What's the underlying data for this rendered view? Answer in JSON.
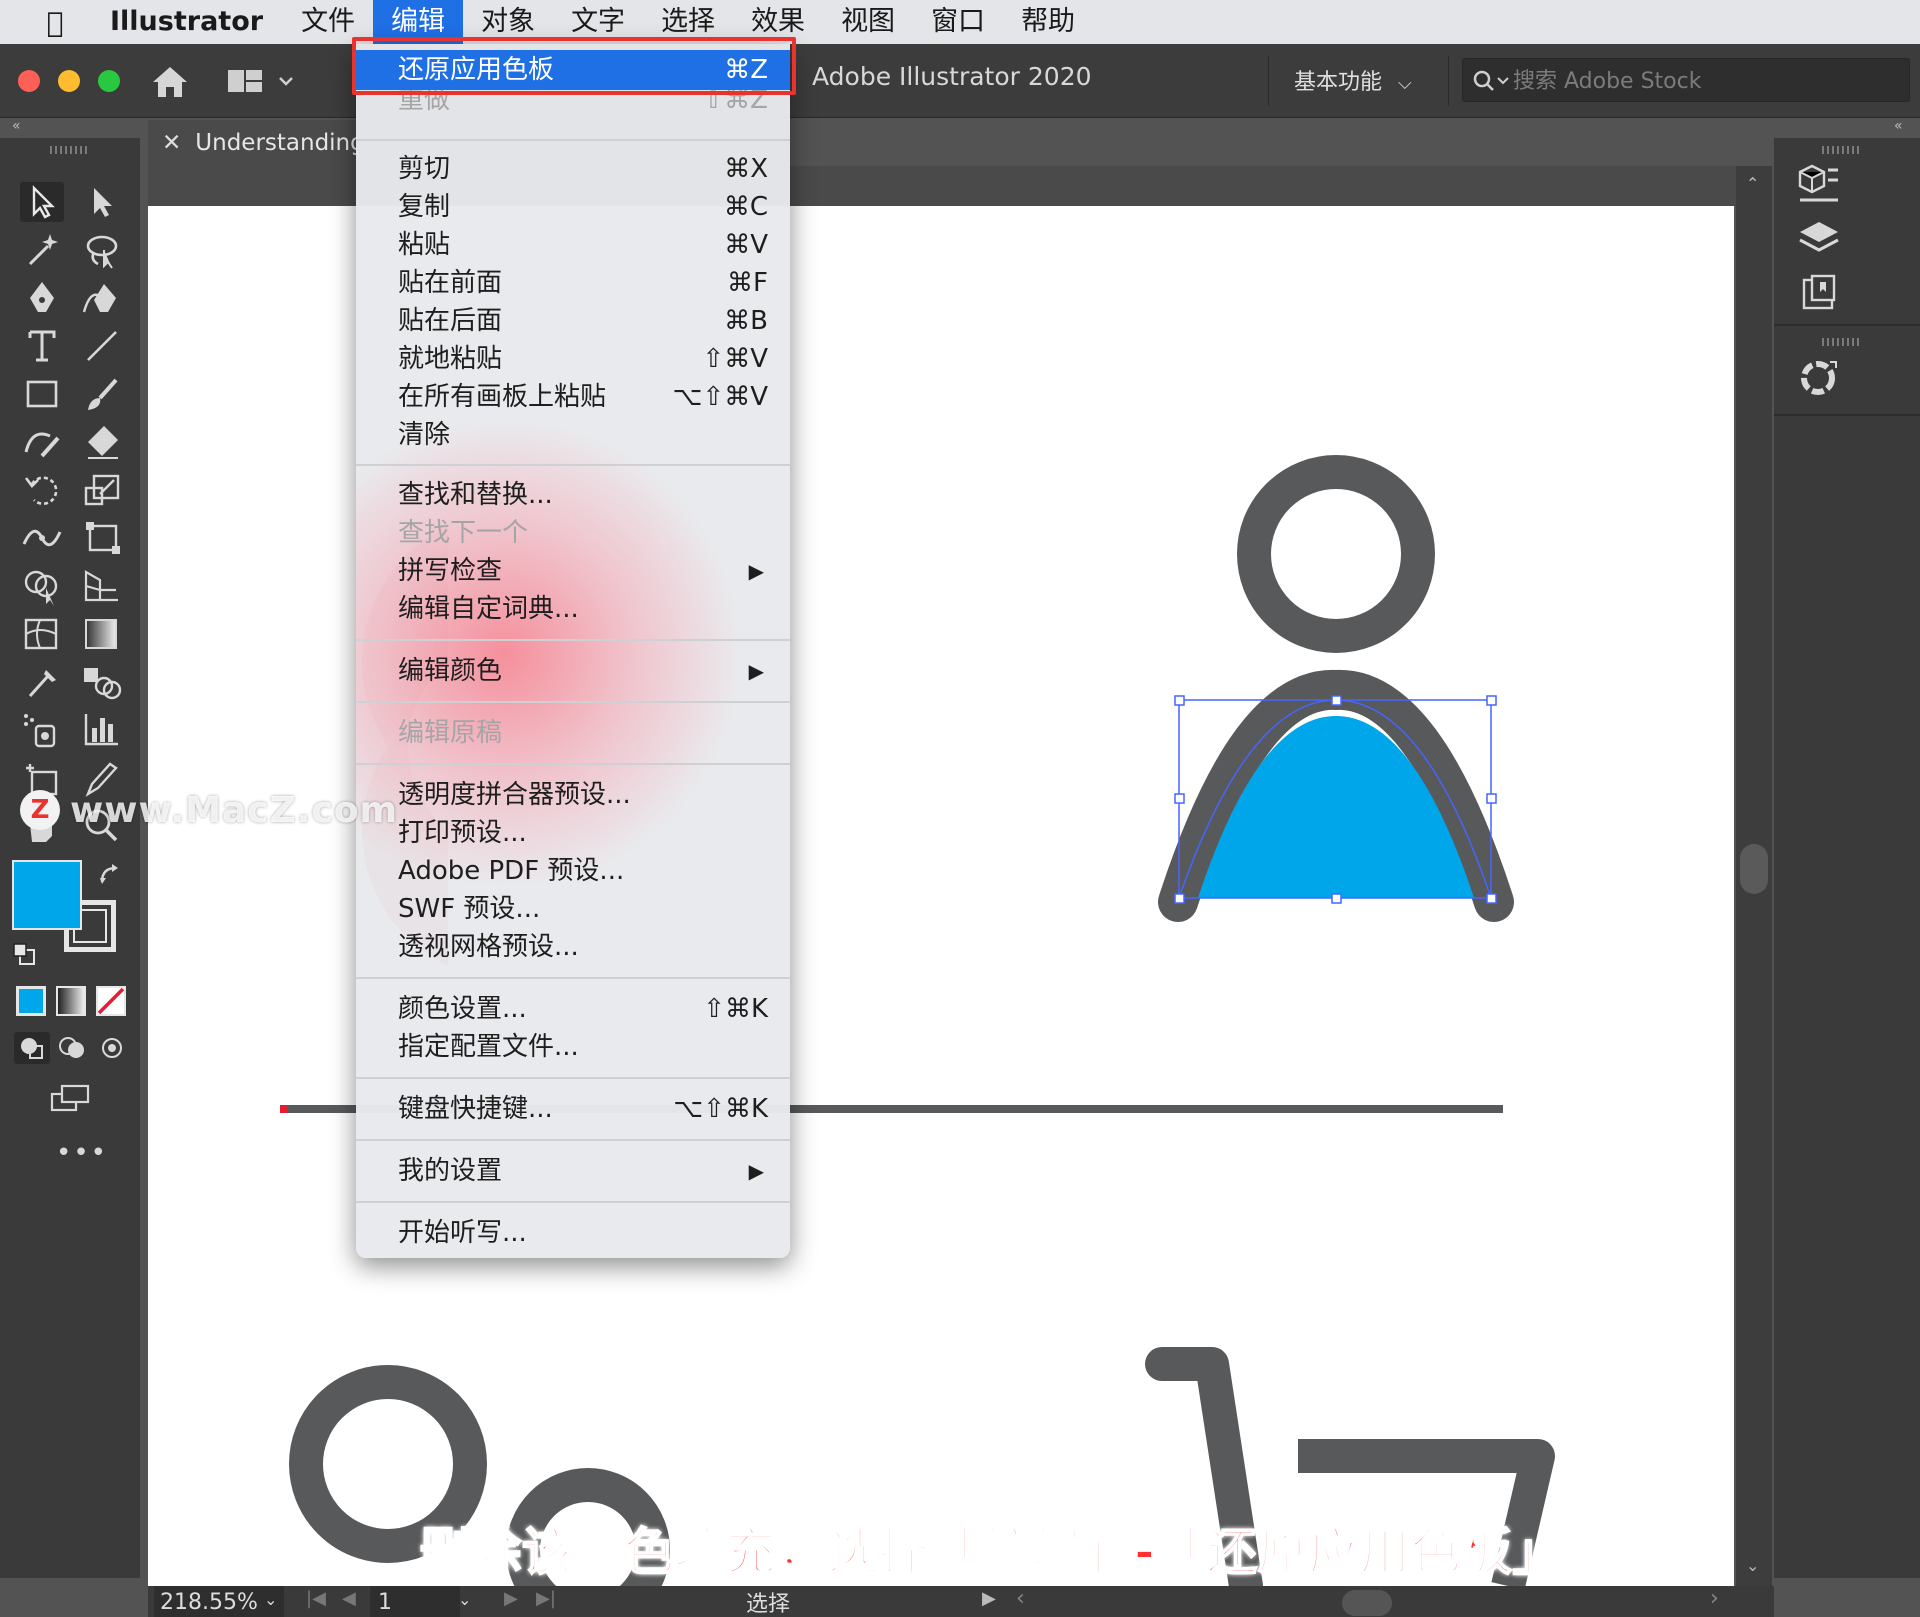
{
  "menubar": {
    "app_name": "Illustrator",
    "items": [
      "文件",
      "编辑",
      "对象",
      "文字",
      "选择",
      "效果",
      "视图",
      "窗口",
      "帮助"
    ]
  },
  "titlebar": {
    "app_title": "Adobe Illustrator 2020",
    "workspace": "基本功能",
    "search_placeholder": "搜索 Adobe Stock"
  },
  "document": {
    "tab_name": "Understanding_"
  },
  "edit_menu": {
    "groups": [
      [
        {
          "label": "还原应用色板",
          "shortcut": "⌘Z",
          "state": "highlighted"
        },
        {
          "label": "重做",
          "shortcut": "⇧⌘Z",
          "state": "disabled"
        }
      ],
      [
        {
          "label": "剪切",
          "shortcut": "⌘X"
        },
        {
          "label": "复制",
          "shortcut": "⌘C"
        },
        {
          "label": "粘贴",
          "shortcut": "⌘V"
        },
        {
          "label": "贴在前面",
          "shortcut": "⌘F"
        },
        {
          "label": "贴在后面",
          "shortcut": "⌘B"
        },
        {
          "label": "就地粘贴",
          "shortcut": "⇧⌘V"
        },
        {
          "label": "在所有画板上粘贴",
          "shortcut": "⌥⇧⌘V"
        },
        {
          "label": "清除",
          "shortcut": ""
        }
      ],
      [
        {
          "label": "查找和替换...",
          "shortcut": ""
        },
        {
          "label": "查找下一个",
          "shortcut": "",
          "state": "disabled"
        },
        {
          "label": "拼写检查",
          "shortcut": "",
          "submenu": true
        },
        {
          "label": "编辑自定词典...",
          "shortcut": ""
        }
      ],
      [
        {
          "label": "编辑颜色",
          "shortcut": "",
          "submenu": true
        }
      ],
      [
        {
          "label": "编辑原稿",
          "shortcut": "",
          "state": "disabled"
        }
      ],
      [
        {
          "label": "透明度拼合器预设...",
          "shortcut": ""
        },
        {
          "label": "打印预设...",
          "shortcut": ""
        },
        {
          "label": "Adobe PDF 预设...",
          "shortcut": ""
        },
        {
          "label": "SWF 预设...",
          "shortcut": ""
        },
        {
          "label": "透视网格预设...",
          "shortcut": ""
        }
      ],
      [
        {
          "label": "颜色设置...",
          "shortcut": "⇧⌘K"
        },
        {
          "label": "指定配置文件...",
          "shortcut": ""
        }
      ],
      [
        {
          "label": "键盘快捷键...",
          "shortcut": "⌥⇧⌘K"
        }
      ],
      [
        {
          "label": "我的设置",
          "shortcut": "",
          "submenu": true
        }
      ],
      [
        {
          "label": "开始听写...",
          "shortcut": ""
        }
      ]
    ]
  },
  "statusbar": {
    "zoom": "218.55%",
    "artboard": "1",
    "tool_name": "选择"
  },
  "overlay": {
    "watermark": "www.MacZ.com",
    "watermark_logo": "Z",
    "caption": "删除该颜色填充，选择「编辑」-「还原应用色板」"
  },
  "colors": {
    "fill": "#00a6ea",
    "dark_gray": "#58595b",
    "red": "#e31e34",
    "highlight": "#1f6fe5",
    "annotation": "#e8332e"
  },
  "icons": {
    "toolbar": [
      "selection-tool-icon",
      "direct-selection-tool-icon",
      "magic-wand-icon",
      "lasso-icon",
      "pen-tool-icon",
      "curvature-tool-icon",
      "type-tool-icon",
      "line-tool-icon",
      "rectangle-tool-icon",
      "paintbrush-icon",
      "shaper-tool-icon",
      "eraser-icon",
      "rotate-tool-icon",
      "scale-tool-icon",
      "width-tool-icon",
      "free-transform-icon",
      "shape-builder-icon",
      "perspective-grid-icon",
      "mesh-tool-icon",
      "gradient-tool-icon",
      "eyedropper-icon",
      "blend-tool-icon",
      "symbol-sprayer-icon",
      "graph-tool-icon",
      "artboard-tool-icon",
      "slice-tool-icon",
      "hand-tool-icon",
      "zoom-tool-icon"
    ],
    "right_panel": [
      "properties-icon",
      "layers-icon",
      "libraries-icon",
      "color-guide-icon"
    ]
  }
}
